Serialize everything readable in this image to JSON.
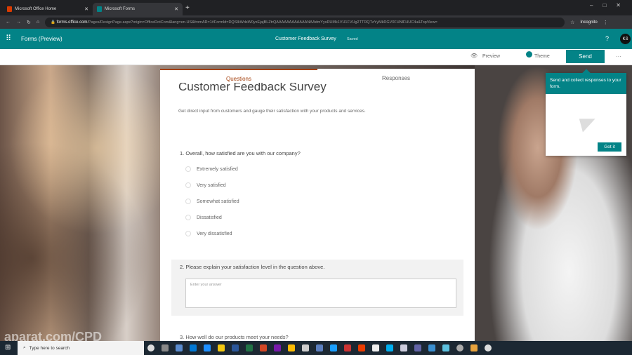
{
  "browser": {
    "tabs": [
      {
        "label": "Microsoft Office Home"
      },
      {
        "label": "Microsoft Forms"
      }
    ],
    "url_host": "forms.office.com",
    "url_path": "/Pages/DesignPage.aspx?origin=OfficeDotCom&lang=en-US&fromAR=1#FormId=DQSIkWdsW0yxEjajBLZtrQAAAAAAAAAAAANAAdmYysRUMk1VU1FVUg2TTRQTzYyMkRGV0FHNlFHUC4u&TopView=",
    "profile": "Incognito"
  },
  "header": {
    "app": "Forms (Preview)",
    "title": "Customer Feedback Survey",
    "status": "Saved",
    "help": "?",
    "avatar": "KS"
  },
  "toolbar": {
    "preview": "Preview",
    "theme": "Theme",
    "send": "Send",
    "more": "···"
  },
  "tooltip": {
    "text": "Send and collect responses to your form.",
    "button": "Got it"
  },
  "form": {
    "tabs": [
      "Questions",
      "Responses"
    ],
    "title": "Customer Feedback Survey",
    "description": "Get direct input from customers and gauge their satisfaction with your products and services.",
    "q1": {
      "text": "1. Overall, how satisfied are you with our company?",
      "options": [
        "Extremely satisfied",
        "Very satisfied",
        "Somewhat satisfied",
        "Dissatisfied",
        "Very dissatisfied"
      ]
    },
    "q2": {
      "text": "2. Please explain your satisfaction level in the question above.",
      "placeholder": "Enter your answer"
    },
    "q3": {
      "text": "3. How well do our products meet your needs?"
    }
  },
  "watermark": "aparat.com/CPD",
  "taskbar": {
    "search_placeholder": "Type here to search"
  },
  "colors": {
    "brand": "#038387"
  }
}
